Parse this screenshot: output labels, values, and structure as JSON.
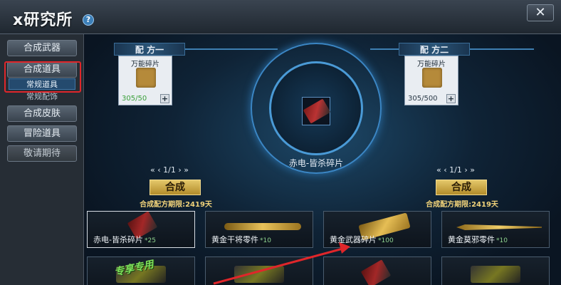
{
  "window": {
    "title": "x研究所",
    "help": "?",
    "close": "✕"
  },
  "sidebar": {
    "items": [
      {
        "label": "合成武器"
      },
      {
        "label": "合成道具"
      },
      {
        "label": "常规道具"
      },
      {
        "label": "常规配饰"
      },
      {
        "label": "合成皮肤"
      },
      {
        "label": "冒险道具"
      },
      {
        "label": "敬请期待"
      }
    ]
  },
  "recipes": [
    {
      "title": "配 方一",
      "item_name": "万能碎片",
      "count": "305/50",
      "plus": "+"
    },
    {
      "title": "配 方二",
      "item_name": "万能碎片",
      "count": "305/500",
      "plus": "+"
    }
  ],
  "center": {
    "name": "赤电-皆杀碎片"
  },
  "pagers": [
    {
      "text": "« ‹ 1/1 › »"
    },
    {
      "text": "« ‹ 1/1 › »"
    }
  ],
  "craft": [
    {
      "label": "合成",
      "deadline": "合成配方期限:2419天"
    },
    {
      "label": "合成",
      "deadline": "合成配方期限:2419天"
    }
  ],
  "items": [
    {
      "name": "赤电-皆杀碎片",
      "qty": "*25"
    },
    {
      "name": "黄金干将零件",
      "qty": "*10"
    },
    {
      "name": "黄金武器碎片",
      "qty": "*100"
    },
    {
      "name": "黄金莫邪零件",
      "qty": "*10"
    }
  ],
  "special_tag": "专享专用",
  "colors": {
    "accent_red": "#e0262a",
    "gold": "#e4c76a",
    "frame_blue": "#3e7fb2"
  }
}
